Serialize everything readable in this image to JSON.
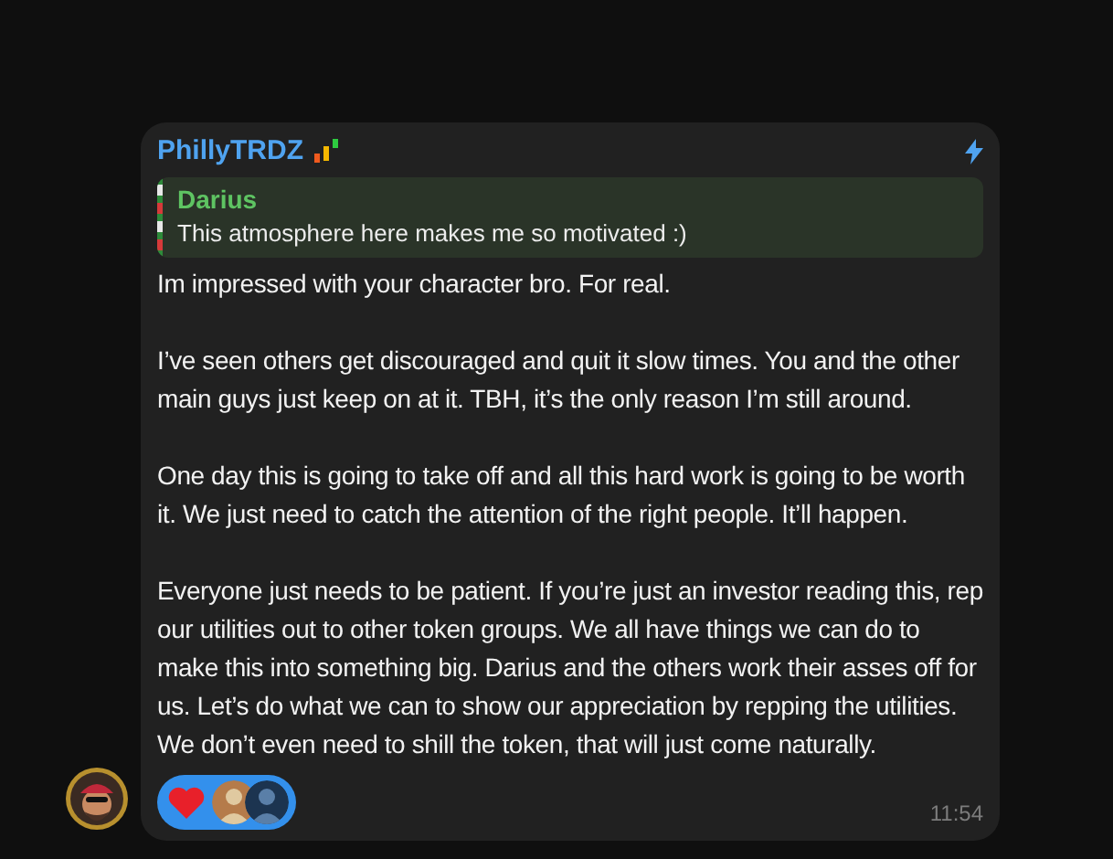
{
  "message": {
    "sender": "PhillyTRDZ",
    "reply": {
      "author": "Darius",
      "text": "This atmosphere here makes me so motivated :)"
    },
    "paragraphs": [
      "Im impressed with your character bro. For real.",
      "I’ve seen others get discouraged and quit it slow times. You and the other main guys just keep on at it. TBH, it’s the only reason I’m still around.",
      "One day this is going to take off and all this hard work is going to be worth it.  We just need to catch the attention of the right people.  It’ll happen.",
      "Everyone just needs to be patient. If you’re just an investor reading this, rep our utilities out to other token groups.  We all have things we can do to make this into something big.  Darius and the others work their asses off for us. Let’s do what we can to show our appreciation by repping the utilities.  We don’t even need to shill the token, that will just come naturally."
    ],
    "reactions": [
      {
        "kind": "heart",
        "selected": true
      }
    ],
    "time": "11:54"
  }
}
